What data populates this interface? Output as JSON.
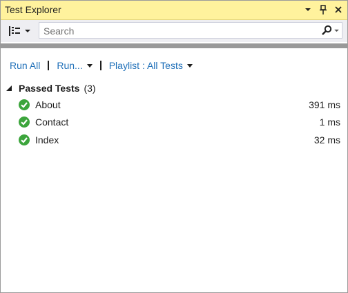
{
  "window": {
    "title": "Test Explorer"
  },
  "toolbar": {
    "search_placeholder": "Search"
  },
  "commands": {
    "run_all": "Run All",
    "run": "Run...",
    "playlist": "Playlist : All Tests"
  },
  "group": {
    "label": "Passed Tests",
    "count": "(3)",
    "status_color": "#3ca53c"
  },
  "tests": [
    {
      "name": "About",
      "time": "391 ms"
    },
    {
      "name": "Contact",
      "time": "1 ms"
    },
    {
      "name": "Index",
      "time": "32 ms"
    }
  ],
  "colors": {
    "titlebar": "#fff29d",
    "link": "#1e6fb8"
  }
}
